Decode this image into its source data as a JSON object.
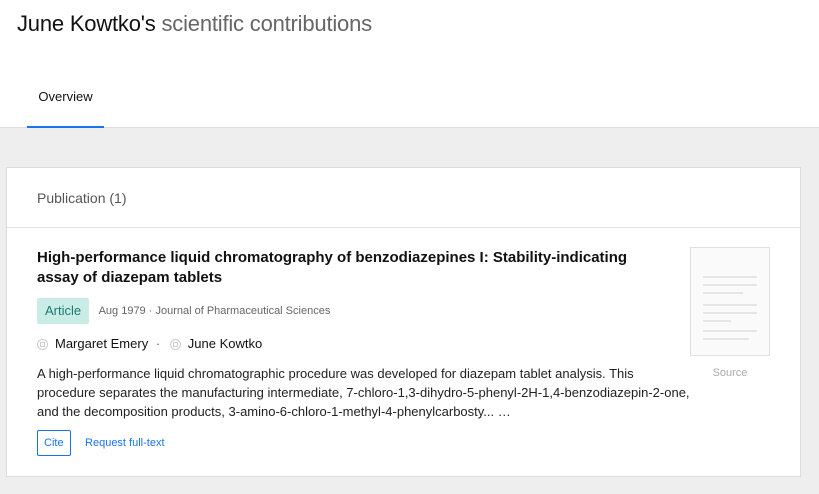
{
  "header": {
    "title_name": "June Kowtko's",
    "title_rest": "scientific contributions",
    "tabs": [
      {
        "label": "Overview",
        "active": true
      }
    ]
  },
  "section": {
    "heading": "Publication (1)"
  },
  "publication": {
    "title": "High-performance liquid chromatography of benzodiazepines I: Stability-indicating assay of diazepam tablets",
    "type_badge": "Article",
    "meta": "Aug 1979 · Journal of Pharmaceutical Sciences",
    "authors": [
      "Margaret Emery",
      "June Kowtko"
    ],
    "author_separator": "·",
    "abstract": "A high-performance liquid chromatographic procedure was developed for diazepam tablet analysis. This procedure separates the manufacturing intermediate, 7-chloro-1,3-dihydro-5-phenyl-2H-1,4-benzodiazepin-2-one, and the decomposition products, 3-amino-6-chloro-1-methyl-4-phenylcarbosty... …",
    "cite_label": "Cite",
    "request_label": "Request full-text",
    "source_label": "Source"
  },
  "colors": {
    "accent": "#1a73e8",
    "badge_bg": "#c9ece7",
    "badge_text": "#1b7a6d"
  },
  "icons": {
    "author": "author-avatar-icon",
    "thumbnail": "document-preview"
  }
}
